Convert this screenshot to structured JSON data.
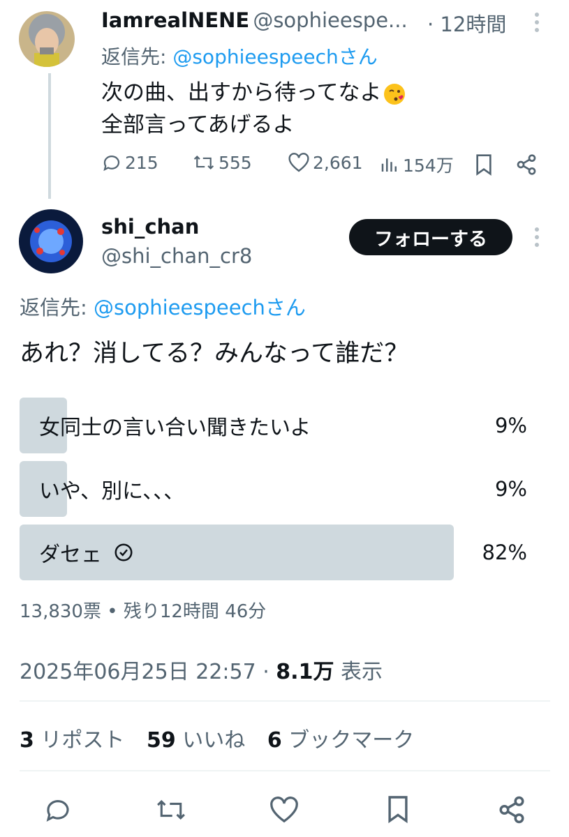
{
  "parent_tweet": {
    "display_name": "IamrealNENE",
    "handle": "@sophieespe...",
    "time": "· 12時間",
    "reply_prefix": "返信先: ",
    "reply_to": "@sophieespeechさん",
    "text_line1": "次の曲、出すから待ってなよ",
    "emoji": "kissing-face-emoji",
    "text_line2": "全部言ってあげるよ",
    "stats": {
      "replies": "215",
      "reposts": "555",
      "likes": "2,661",
      "views": "154万"
    }
  },
  "main_tweet": {
    "display_name": "shi_chan",
    "handle": "@shi_chan_cr8",
    "follow_label": "フォローする",
    "reply_prefix": "返信先: ",
    "reply_to": "@sophieespeechさん",
    "text": "あれ？消してる？みんなって誰だ？",
    "poll": {
      "options": [
        {
          "label": "女同士の言い合い聞きたいよ",
          "percent_text": "9%",
          "percent": 9,
          "selected": false
        },
        {
          "label": "いや、別に、、、",
          "percent_text": "9%",
          "percent": 9,
          "selected": false
        },
        {
          "label": "ダセェ",
          "percent_text": "82%",
          "percent": 82,
          "selected": true
        }
      ],
      "votes": "13,830票",
      "remaining": "• 残り12時間 46分"
    },
    "timestamp": "2025年06月25日 22:57 · ",
    "views_count": "8.1万",
    "views_label": " 表示",
    "engagement": {
      "reposts_count": "3",
      "reposts_label": " リポスト",
      "likes_count": "59",
      "likes_label": " いいね",
      "bookmarks_count": "6",
      "bookmarks_label": " ブックマーク"
    }
  },
  "colors": {
    "link": "#1d9bf0",
    "muted": "#536471",
    "poll_fill": "#cfd9de",
    "button": "#0f1419"
  }
}
